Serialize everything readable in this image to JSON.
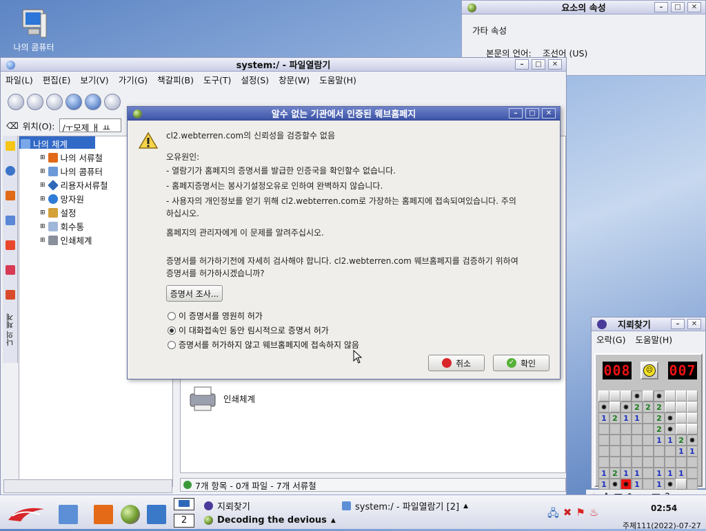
{
  "desktop": {
    "icon_label": "나의 콤퓨터"
  },
  "props": {
    "title": "요소의 속성",
    "section": "가타 속성",
    "lang_label": "본문의 언어:",
    "lang_value": "조선어 (US)"
  },
  "filemanager": {
    "title": "system:/ - 파일열람기",
    "menu": [
      "파일(L)",
      "편집(E)",
      "보기(V)",
      "가기(G)",
      "책갈피(B)",
      "도구(T)",
      "설정(S)",
      "창문(W)",
      "도움말(H)"
    ],
    "location_label": "위치(O):",
    "location_value": "/ㅜ모제 ㅐ ㅛ",
    "tree": [
      "나의 체계",
      "나의 서류철",
      "나의 콤퓨터",
      "리용자서류철",
      "망자원",
      "설정",
      "회수통",
      "인쇄체계"
    ],
    "side_tab": "나의 체계",
    "print_item": "인쇄체계",
    "status": "7개 항목 - 0개 파일 - 7개 서류철"
  },
  "dialog": {
    "title": "알수 없는 기관에서 인증된 웨브홈페지",
    "headline": "cl2.webterren.com의 신뢰성을 검증할수 없음",
    "reason_label": "오유원인:",
    "reasons": [
      "- 열람기가 홈페지의 증명서를 발급한 인증국을 확인할수 없습니다.",
      "- 홈페지증명서는 봉사기설정오유로 인하여 완벽하지 않습니다.",
      "- 사용자의 개인정보를 얻기 위해 cl2.webterren.com로 가장하는 홈페지에 접속되여있습니다. 주의",
      "하십시오."
    ],
    "notify": "홈페지의 관리자에게 이 문제를 알려주십시오.",
    "check1": "증명서를 허가하기전에 자세히 검사해야 합니다. cl2.webterren.com 웨브홈페지를 검증하기 위하여",
    "check2": "증명서를 허가하시겠습니까?",
    "inspect_btn": "증명서 조사...",
    "options": [
      "이 증명서를 영원히 허가",
      "이 대화접속인 동안 림시적으로 증명서 허가",
      "증명서를 허가하지 않고 웨브홈페지에 접속하지 않음"
    ],
    "selected_option": 1,
    "cancel_btn": "취소",
    "ok_btn": "확인"
  },
  "mines": {
    "title": "지뢰찾기",
    "menu": [
      "오락(G)",
      "도움말(H)"
    ],
    "left_counter": "008",
    "right_counter": "007"
  },
  "taskbar": {
    "desktop_num": "2",
    "tasks": [
      "지뢰찾기",
      "system:/ - 파일열람기 [2]",
      "Decoding the devious"
    ],
    "clock": "02:54",
    "date": "주체111(2022)-07-27"
  },
  "colors": {
    "dialog_title": "#3d55a8",
    "lcd_red": "#e11",
    "selection": "#3169c6"
  }
}
